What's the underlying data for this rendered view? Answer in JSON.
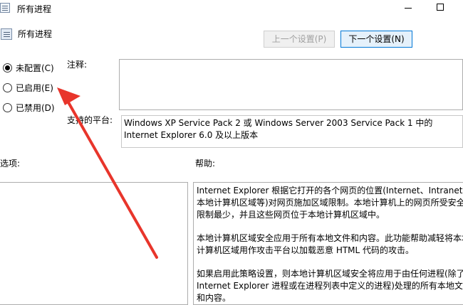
{
  "window": {
    "title": "所有进程"
  },
  "policy": {
    "title": "所有进程"
  },
  "buttons": {
    "prev_label": "上一个设置(P)",
    "next_label": "下一个设置(N)"
  },
  "radios": [
    {
      "label": "未配置(C)",
      "checked": true
    },
    {
      "label": "已启用(E)",
      "checked": false
    },
    {
      "label": "已禁用(D)",
      "checked": false
    }
  ],
  "comment": {
    "label": "注释:",
    "value": ""
  },
  "platform": {
    "label": "支持的平台:",
    "value": "Windows XP Service Pack 2 或 Windows Server 2003 Service Pack 1 中的 Internet Explorer 6.0 及以上版本"
  },
  "options": {
    "label": "选项:"
  },
  "help": {
    "label": "帮助:",
    "paragraphs": [
      [
        "Internet Explorer 根据它打开的各个网页的位置(Internet、Intranet、",
        "本地计算机区域等)对网页施加区域限制。本地计算机上的网页所受安全",
        "限制最少，并且这些网页位于本地计算机区域中。"
      ],
      [
        "本地计算机区域安全应用于所有本地文件和内容。此功能帮助减轻将本地",
        "计算机区域用作攻击平台以加载恶意 HTML 代码的攻击。"
      ],
      [
        "如果启用此策略设置，则本地计算机区域安全将应用于由任何进程(除了",
        "Internet Explorer 进程或在进程列表中定义的进程)处理的所有本地文件",
        "和内容。"
      ]
    ]
  },
  "colors": {
    "annotation_arrow": "#e8352b",
    "button_focus": "#0078d7"
  },
  "icons": {
    "title": "policy-setting-icon",
    "policy": "policy-setting-icon"
  }
}
